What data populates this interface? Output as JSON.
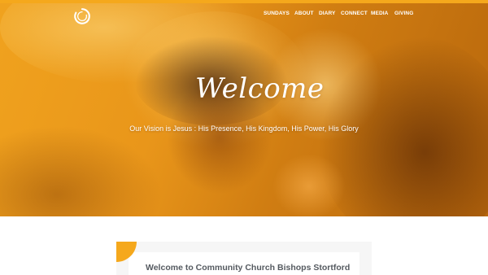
{
  "nav": {
    "items": [
      {
        "label": "SUNDAYS"
      },
      {
        "label": "ABOUT"
      },
      {
        "label": "DIARY"
      },
      {
        "label": "CONNECT"
      },
      {
        "label": "MEDIA"
      },
      {
        "label": "GIVING"
      }
    ]
  },
  "hero": {
    "heading": "Welcome",
    "subheading": "Our Vision is Jesus : His Presence, His Kingdom, His Power, His Glory"
  },
  "intro": {
    "title": "Welcome to Community Church Bishops Stortford"
  },
  "icons": {
    "logo": "church-logo-icon"
  },
  "colors": {
    "accent": "#f5a81c",
    "text_dark": "#555a60",
    "white": "#ffffff"
  }
}
